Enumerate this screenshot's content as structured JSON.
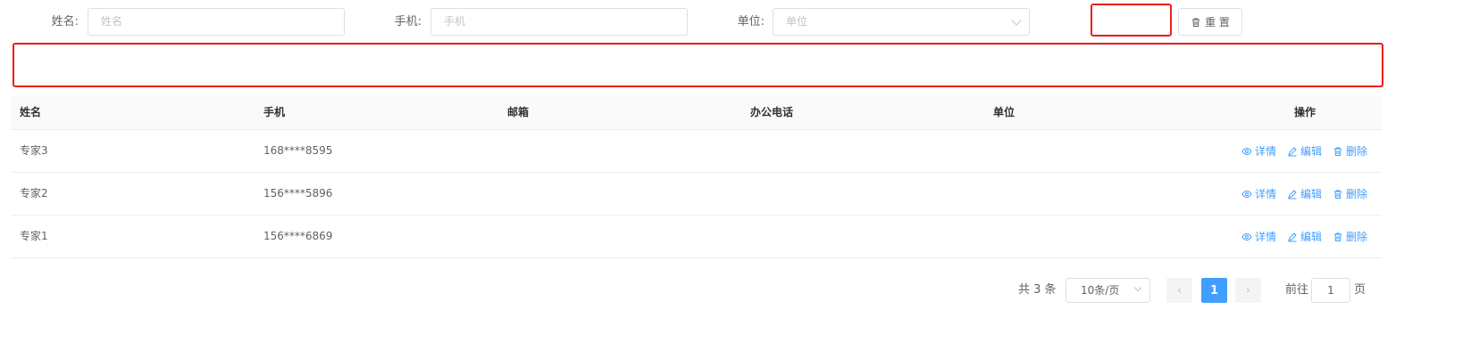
{
  "search": {
    "name_label": "姓名:",
    "name_placeholder": "姓名",
    "phone_label": "手机:",
    "phone_placeholder": "手机",
    "unit_label": "单位:",
    "unit_placeholder": "单位",
    "reset_label": "重 置"
  },
  "table": {
    "headers": {
      "name": "姓名",
      "phone": "手机",
      "email": "邮箱",
      "office_phone": "办公电话",
      "unit": "单位",
      "actions": "操作"
    },
    "rows": [
      {
        "name": "专家3",
        "phone": "168****8595",
        "email": "",
        "office_phone": "",
        "unit": ""
      },
      {
        "name": "专家2",
        "phone": "156****5896",
        "email": "",
        "office_phone": "",
        "unit": ""
      },
      {
        "name": "专家1",
        "phone": "156****6869",
        "email": "",
        "office_phone": "",
        "unit": ""
      }
    ],
    "action_labels": {
      "detail": "详情",
      "edit": "编辑",
      "delete": "删除"
    }
  },
  "pagination": {
    "total_text": "共 3 条",
    "page_size": "10条/页",
    "prev": "‹",
    "next": "›",
    "current_page": "1",
    "goto_prefix": "前往",
    "goto_value": "1",
    "goto_suffix": "页"
  },
  "colors": {
    "accent": "#409eff",
    "highlight_border": "#e8201c"
  }
}
